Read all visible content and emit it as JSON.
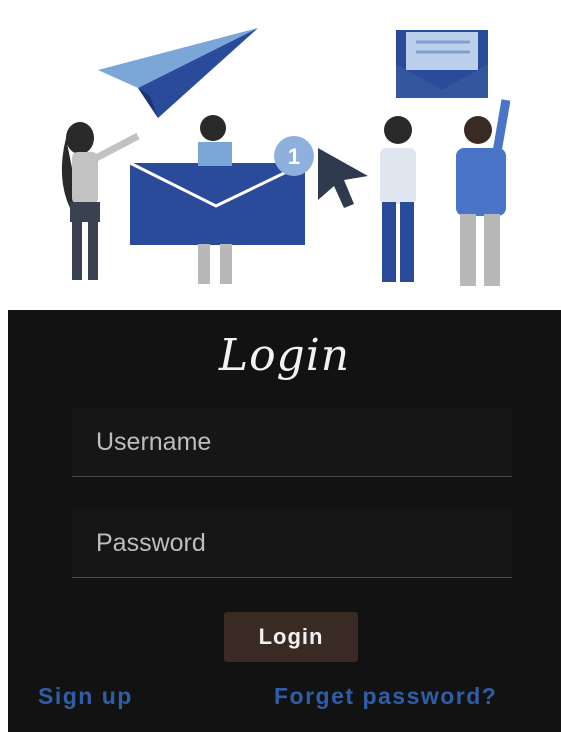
{
  "login": {
    "title": "Login",
    "username_placeholder": "Username",
    "password_placeholder": "Password",
    "button_label": "Login",
    "signup_label": "Sign up",
    "forget_label": "Forget password?"
  },
  "hero": {
    "badge_count": "1"
  },
  "colors": {
    "panel_bg": "#121212",
    "button_bg": "#3a2a24",
    "link": "#2f5ea8",
    "illustration_blue": "#2a4a9a"
  }
}
